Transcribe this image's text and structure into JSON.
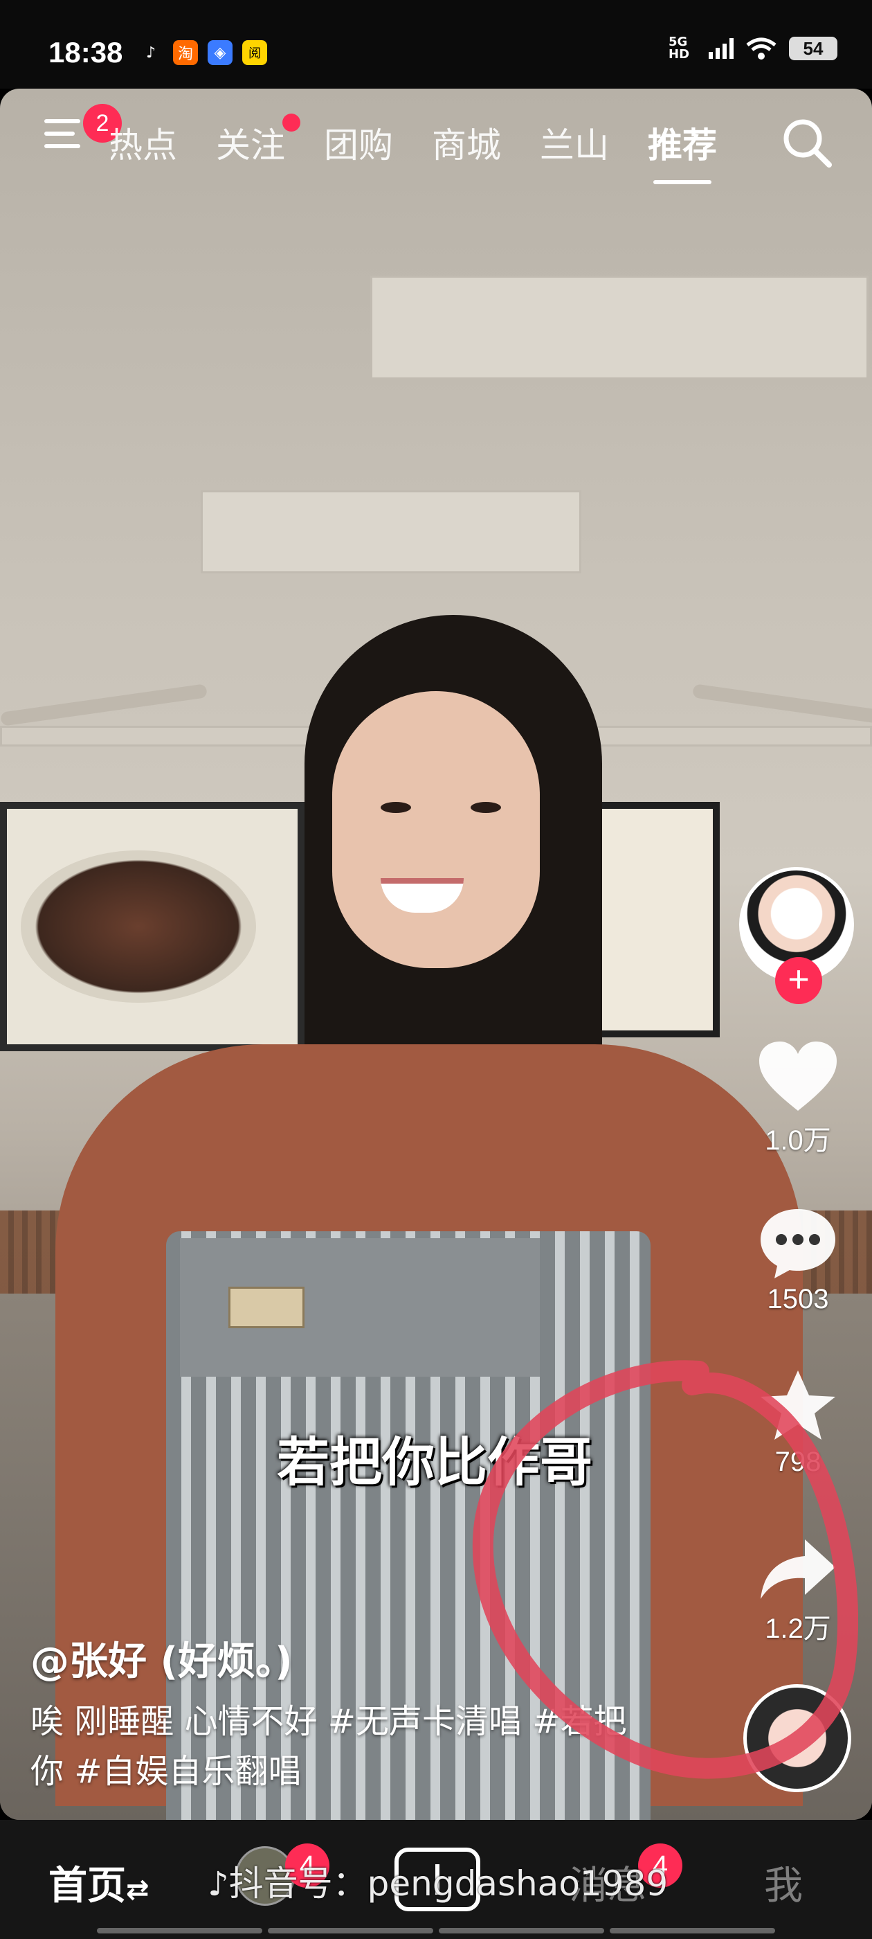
{
  "status_bar": {
    "time": "18:38",
    "network": "5G HD",
    "battery": "54",
    "app_icons": [
      "tiktok-icon",
      "taobao-icon",
      "browser-icon",
      "reader-icon"
    ]
  },
  "top_nav": {
    "menu_badge": "2",
    "tabs": [
      {
        "label": "热点",
        "visible_text": "热点"
      },
      {
        "label": "关注",
        "has_dot": true
      },
      {
        "label": "团购"
      },
      {
        "label": "商城"
      },
      {
        "label": "兰山"
      },
      {
        "label": "推荐",
        "active": true
      }
    ]
  },
  "actions": {
    "likes": "1.0万",
    "comments": "1503",
    "favorites": "798",
    "shares": "1.2万"
  },
  "video": {
    "subtitle": "若把你比作哥",
    "author": "@张好 (好烦。)",
    "caption": "唉 刚睡醒 心情不好 #无声卡清唱 #若把你 #自娱自乐翻唱"
  },
  "bottom_nav": {
    "home": "首页",
    "home_swap": "⇄",
    "friends_badge": "4",
    "messages": "消息",
    "messages_badge": "4",
    "me": "我",
    "watermark": "抖音号：pengdashao1989"
  },
  "colors": {
    "accent": "#fe2c55",
    "annotation": "#e0465a"
  }
}
